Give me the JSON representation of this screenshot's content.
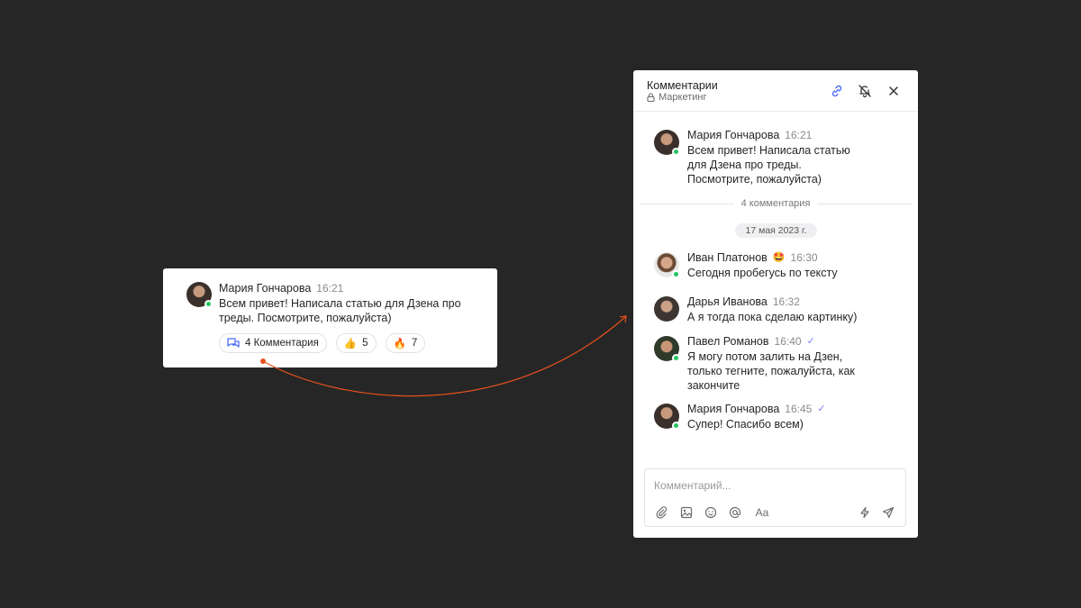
{
  "card": {
    "author": "Мария Гончарова",
    "time": "16:21",
    "message": "Всем привет! Написала статью для Дзена про треды. Посмотрите, пожалуйста)",
    "comments_chip": "4 Комментария",
    "reactions": [
      {
        "emoji": "👍",
        "count": "5"
      },
      {
        "emoji": "🔥",
        "count": "7"
      }
    ]
  },
  "panel": {
    "title": "Комментарии",
    "channel": "Маркетинг",
    "root": {
      "author": "Мария Гончарова",
      "time": "16:21",
      "message": "Всем привет! Написала статью для Дзена про треды. Посмотрите, пожалуйста)"
    },
    "comments_count_label": "4 комментария",
    "date_label": "17 мая 2023 г.",
    "messages": [
      {
        "author": "Иван Платонов",
        "badge": "🤩",
        "time": "16:30",
        "text": "Сегодня пробегусь по тексту"
      },
      {
        "author": "Дарья Иванова",
        "time": "16:32",
        "text": "А я тогда пока сделаю картинку)"
      },
      {
        "author": "Павел Романов",
        "time": "16:40",
        "text": "Я могу потом залить на Дзен, только тегните, пожалуйста, как закончите"
      },
      {
        "author": "Мария Гончарова",
        "time": "16:45",
        "text": "Супер! Спасибо всем)"
      }
    ],
    "composer": {
      "placeholder": "Комментарий...",
      "format_label": "Aa"
    }
  },
  "colors": {
    "background": "#262626",
    "accent": "#4a6cf7",
    "online": "#22c55e",
    "arrow": "#e8501d"
  }
}
